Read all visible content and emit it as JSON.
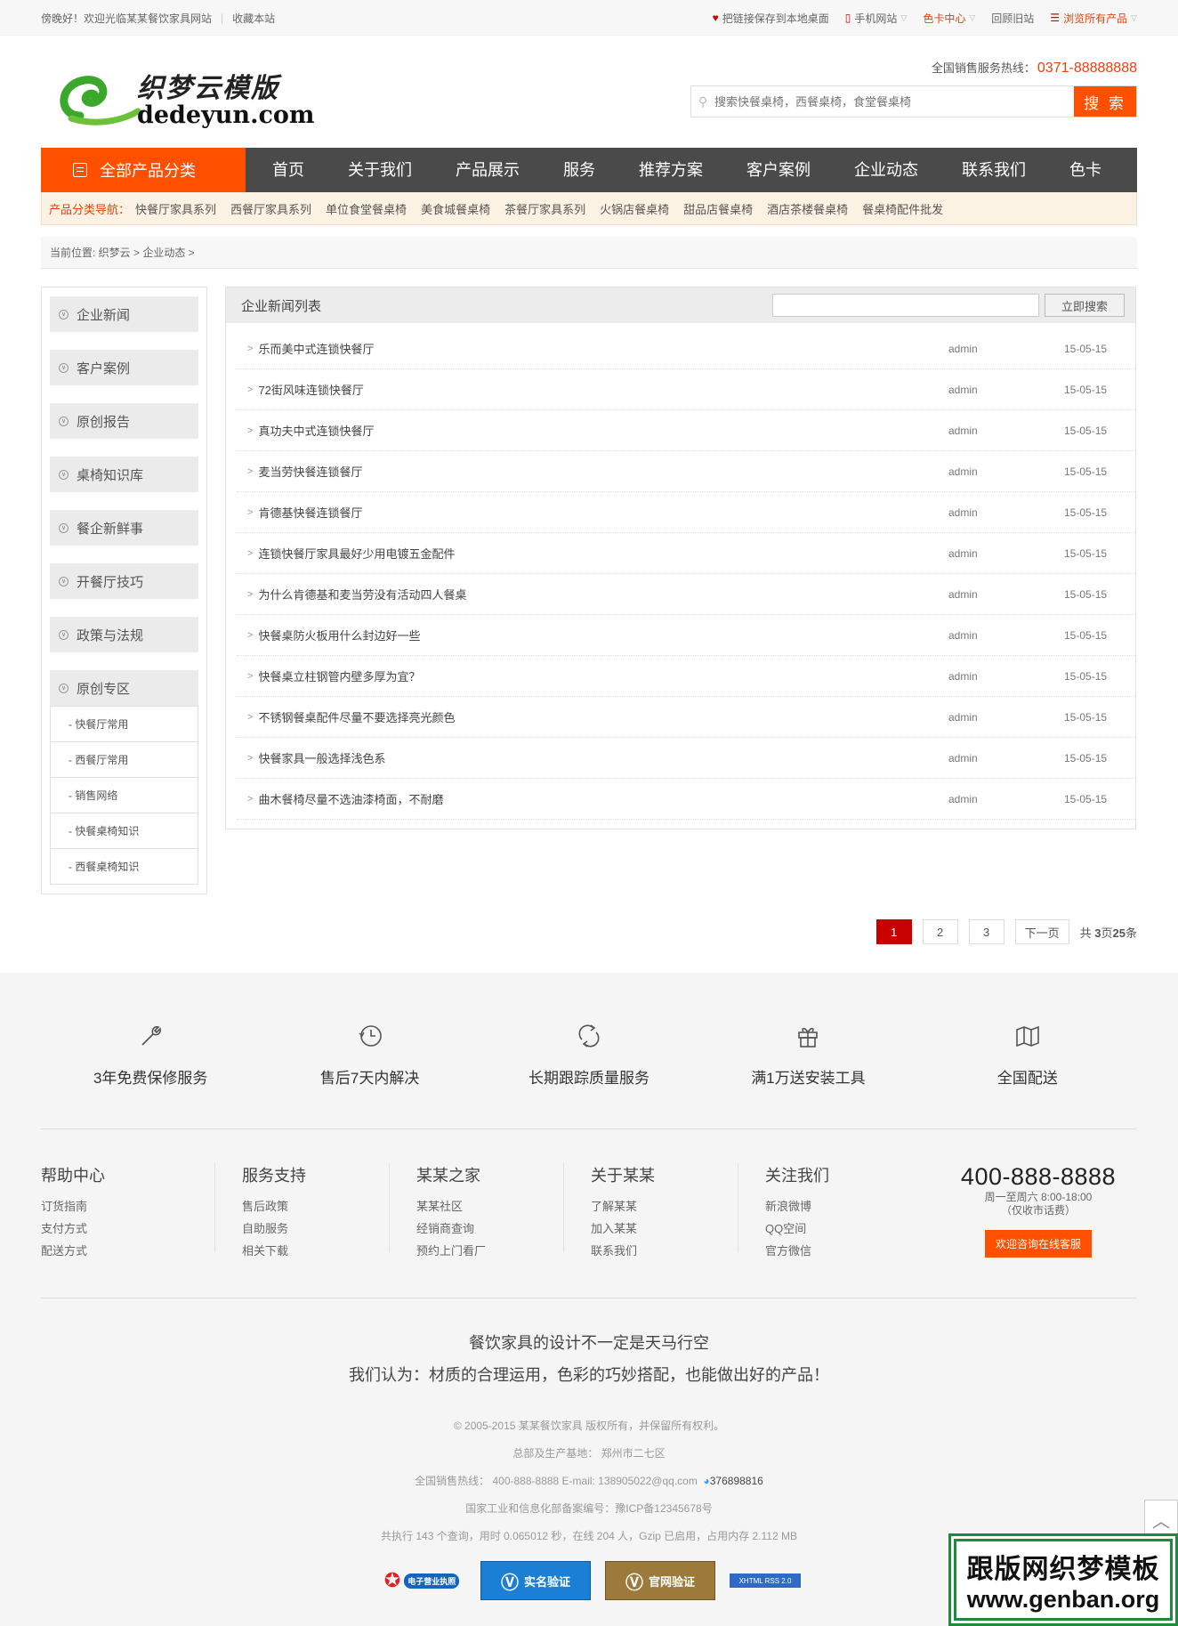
{
  "topbar": {
    "welcome": "傍晚好！欢迎光临某某餐饮家具网站",
    "bookmark": "收藏本站",
    "save_link": "把链接保存到本地桌面",
    "mobile": "手机网站",
    "color_card": "色卡中心",
    "old_site": "回顾旧站",
    "browse_all": "浏览所有产品"
  },
  "header": {
    "logo_cn": "织梦云模版",
    "logo_en": "dedeyun.com",
    "hotline_label": "全国销售服务热线：",
    "hotline_number": "0371-88888888",
    "search_placeholder": "搜索快餐桌椅，西餐桌椅，食堂餐桌椅",
    "search_button": "搜 索"
  },
  "nav": {
    "all_label": "全部产品分类",
    "items": [
      "首页",
      "关于我们",
      "产品展示",
      "服务",
      "推荐方案",
      "客户案例",
      "企业动态",
      "联系我们",
      "色卡"
    ]
  },
  "category_nav": {
    "label": "产品分类导航：",
    "items": [
      "快餐厅家具系列",
      "西餐厅家具系列",
      "单位食堂餐桌椅",
      "美食城餐桌椅",
      "茶餐厅家具系列",
      "火锅店餐桌椅",
      "甜品店餐桌椅",
      "酒店茶楼餐桌椅",
      "餐桌椅配件批发"
    ]
  },
  "breadcrumb": "当前位置: 织梦云 > 企业动态 >",
  "sidebar": {
    "items": [
      "企业新闻",
      "客户案例",
      "原创报告",
      "桌椅知识库",
      "餐企新鲜事",
      "开餐厅技巧",
      "政策与法规",
      "原创专区"
    ],
    "sub_items": [
      "- 快餐厅常用",
      "- 西餐厅常用",
      "- 销售网络",
      "- 快餐桌椅知识",
      "- 西餐桌椅知识"
    ]
  },
  "list": {
    "title": "企业新闻列表",
    "search_button": "立即搜索",
    "rows": [
      {
        "title": "乐而美中式连锁快餐厅",
        "author": "admin",
        "date": "15-05-15"
      },
      {
        "title": "72街风味连锁快餐厅",
        "author": "admin",
        "date": "15-05-15"
      },
      {
        "title": "真功夫中式连锁快餐厅",
        "author": "admin",
        "date": "15-05-15"
      },
      {
        "title": "麦当劳快餐连锁餐厅",
        "author": "admin",
        "date": "15-05-15"
      },
      {
        "title": "肯德基快餐连锁餐厅",
        "author": "admin",
        "date": "15-05-15"
      },
      {
        "title": "连锁快餐厅家具最好少用电镀五金配件",
        "author": "admin",
        "date": "15-05-15"
      },
      {
        "title": "为什么肯德基和麦当劳没有活动四人餐桌",
        "author": "admin",
        "date": "15-05-15"
      },
      {
        "title": "快餐桌防火板用什么封边好一些",
        "author": "admin",
        "date": "15-05-15"
      },
      {
        "title": "快餐桌立柱钢管内壁多厚为宜？",
        "author": "admin",
        "date": "15-05-15"
      },
      {
        "title": "不锈钢餐桌配件尽量不要选择亮光颜色",
        "author": "admin",
        "date": "15-05-15"
      },
      {
        "title": "快餐家具一般选择浅色系",
        "author": "admin",
        "date": "15-05-15"
      },
      {
        "title": "曲木餐椅尽量不选油漆椅面，不耐磨",
        "author": "admin",
        "date": "15-05-15"
      }
    ]
  },
  "pager": {
    "pages": [
      "1",
      "2",
      "3"
    ],
    "current": "1",
    "next": "下一页",
    "total_prefix": "共",
    "total_pages": "3",
    "total_mid": "页",
    "total_records": "25",
    "total_suffix": "条"
  },
  "services": [
    {
      "icon": "wrench-icon",
      "label": "3年免费保修服务"
    },
    {
      "icon": "clock-icon",
      "label": "售后7天内解决"
    },
    {
      "icon": "refresh-icon",
      "label": "长期跟踪质量服务"
    },
    {
      "icon": "gift-icon",
      "label": "满1万送安装工具"
    },
    {
      "icon": "map-icon",
      "label": "全国配送"
    }
  ],
  "footer_links": [
    {
      "title": "帮助中心",
      "links": [
        "订货指南",
        "支付方式",
        "配送方式"
      ]
    },
    {
      "title": "服务支持",
      "links": [
        "售后政策",
        "自助服务",
        "相关下载"
      ]
    },
    {
      "title": "某某之家",
      "links": [
        "某某社区",
        "经销商查询",
        "预约上门看厂"
      ]
    },
    {
      "title": "关于某某",
      "links": [
        "了解某某",
        "加入某某",
        "联系我们"
      ]
    },
    {
      "title": "关注我们",
      "links": [
        "新浪微博",
        "QQ空间",
        "官方微信"
      ]
    }
  ],
  "contact": {
    "phone": "400-888-8888",
    "hours": "周一至周六 8:00-18:00",
    "note": "（仅收市话费）",
    "button": "欢迎咨询在线客服"
  },
  "slogan": {
    "line1": "餐饮家具的设计不一定是天马行空",
    "line2": "我们认为：材质的合理运用，色彩的巧妙搭配，也能做出好的产品！"
  },
  "copyright": {
    "line1": "© 2005-2015 某某餐饮家具 版权所有，并保留所有权利。",
    "line2": "总部及生产基地： 郑州市二七区",
    "line3": "全国销售热线： 400-888-8888    E-mail: 138905022@qq.com",
    "qq": "376898816",
    "line4": "国家工业和信息化部备案编号：豫ICP备12345678号",
    "line5": "共执行 143 个查询，用时 0.065012 秒，在线 204 人，Gzip 已启用，占用内存 2.112 MB"
  },
  "badges": [
    "电子营业执照",
    "实名验证",
    "官网验证",
    "XHTML RSS 2.0"
  ],
  "watermark": {
    "line1": "跟版网织梦模板",
    "line2": "www.genban.org"
  },
  "colors": {
    "accent": "#ff5000",
    "nav_bg": "#4a4a4a",
    "page_current": "#c90000"
  }
}
